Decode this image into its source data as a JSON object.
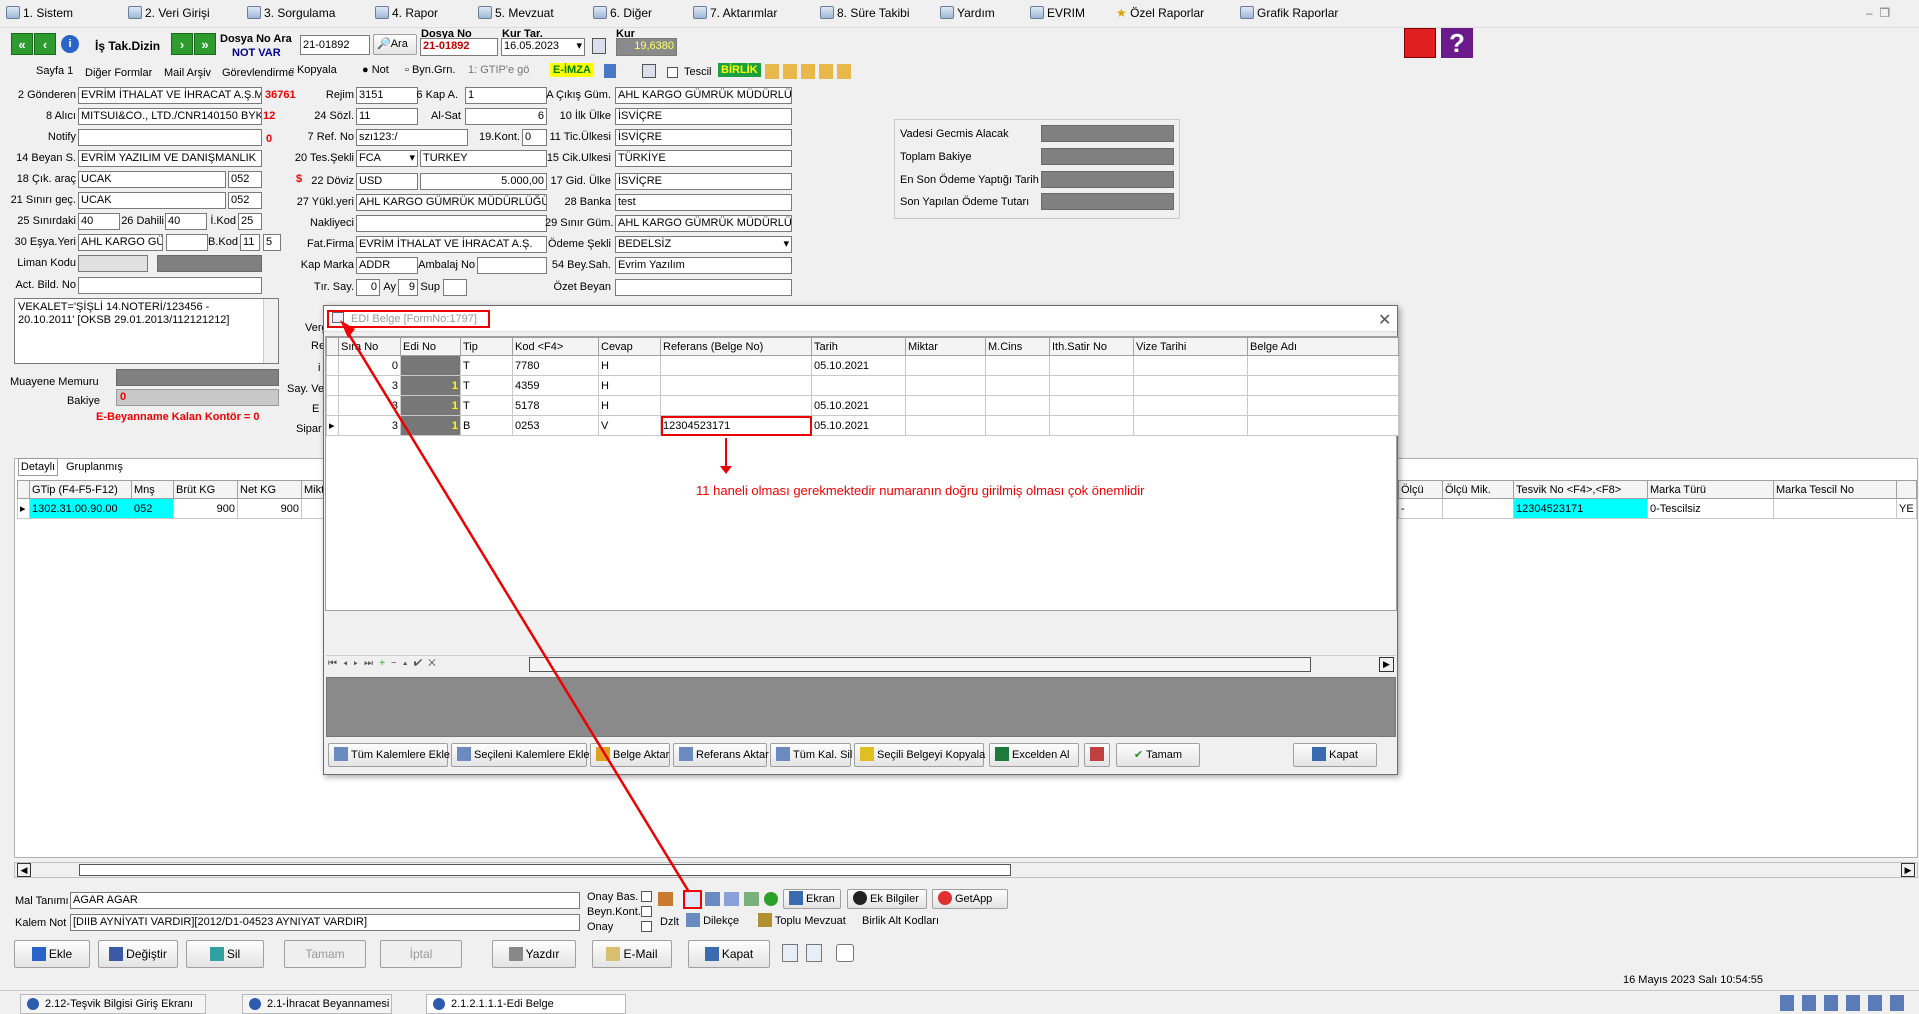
{
  "menu": [
    "1.  Sistem",
    "2.  Veri Girişi",
    "3.  Sorgulama",
    "4.  Rapor",
    "5.  Mevzuat",
    "6.  Diğer",
    "7.  Aktarımlar",
    "8. Süre Takibi",
    "Yardım",
    "EVRIM",
    "Özel Raporlar",
    "Grafik Raporlar"
  ],
  "toolbar": {
    "is_tak_dizin": "İş Tak.Dizin",
    "dosya_no_ara_label": "Dosya No Ara",
    "not_var": "NOT VAR",
    "dosya_no_ara_value": "21-01892",
    "ara_button": "Ara",
    "dosya_no_label": "Dosya No",
    "dosya_no_value": "21-01892",
    "kur_tar_label": "Kur Tar.",
    "kur_tar_value": "16.05.2023",
    "kur_label": "Kur",
    "kur_value": "19,6380"
  },
  "form_tabs": {
    "sayfa1": "Sayfa 1",
    "diger": "Diğer Formlar",
    "mail": "Mail Arşiv",
    "gorev": "Görevlendirme"
  },
  "form_toolbar": {
    "kopyala": "Kopyala",
    "not": "Not",
    "byn": "Byn.Grn.",
    "gtip": "1: GTIP'e gö",
    "eimza": "E-İMZA",
    "tescil": "Tescil",
    "birlik": "BİRLİK"
  },
  "left": {
    "gonderen_label": "2 Gönderen",
    "gonderen": "EVRİM İTHALAT VE İHRACAT A.Ş.M",
    "gonderen_no": "36761",
    "alici_label": "8 Alıcı",
    "alici": "MITSUI&CO., LTD./CNR140150 BYK",
    "alici_no": "12",
    "notify_label": "Notify",
    "notify_no": "0",
    "beyan_label": "14 Beyan S.",
    "beyan": "EVRİM YAZILIM VE DANIŞMANLIK",
    "cik_label": "18 Çık. araç",
    "cik": "UCAK",
    "cik_code": "052",
    "sinir_label": "21 Sınırı geç.",
    "sinir": "UCAK",
    "sinir_code": "052",
    "sinirdaki_label": "25 Sınırdaki",
    "sinirdaki": "40",
    "dahili_label": "26 Dahili",
    "dahili": "40",
    "ikod_label": "İ.Kod",
    "ikod": "25",
    "esya_label": "30 Eşya.Yeri",
    "esya": "AHL KARGO GÜ",
    "bkod_label": "B.Kod",
    "bkod": "11",
    "bkod2": "5",
    "liman_label": "Liman Kodu",
    "act_label": "Act. Bild. No",
    "vekalet": "VEKALET='ŞİŞLİ 14.NOTERİ/123456 - 20.10.2011' [OKSB 29.01.2013/112121212]",
    "muayene_label": "Muayene Memuru",
    "bakiye_label": "Bakiye",
    "bakiye": "0",
    "kontor": "E-Beyanname Kalan Kontör = 0"
  },
  "middle": {
    "rejim_label": "Rejim",
    "rejim": "3151",
    "kap_label": "6 Kap A.",
    "kap": "1",
    "sozl_label": "24 Sözl.",
    "sozl": "11",
    "alsat_label": "Al-Sat",
    "alsat": "6",
    "ref_label": "7 Ref. No",
    "ref": "szı123:/",
    "kont_label": "19.Kont.",
    "kont": "0",
    "tes_label": "20 Tes.Şekli",
    "tes": "FCA",
    "tes_yer": "TURKEY",
    "doviz_label": "22 Döviz",
    "doviz": "USD",
    "doviz_amount": "5.000,00",
    "dollar": "$",
    "yukl_label": "27 Yükl.yeri",
    "yukl": "AHL KARGO GÜMRÜK MÜDÜRLÜĞÜ",
    "nakliyeci_label": "Nakliyeci",
    "fat_label": "Fat.Firma",
    "fat": "EVRİM İTHALAT VE İHRACAT A.Ş.",
    "marka_label": "Kap Marka",
    "marka": "ADDR",
    "ambalaj_label": "Ambalaj No",
    "tir_label": "Tır. Say.",
    "tir": "0",
    "ay_label": "Ay",
    "ay": "9",
    "sup_label": "Sup"
  },
  "right": {
    "cikis_label": "A Çıkış Güm.",
    "cikis": "AHL KARGO GÜMRÜK MÜDÜRLÜĞ",
    "ilk_label": "10 İlk Ülke",
    "ilk": "İSVİÇRE",
    "tic_label": "11 Tic.Ülkesi",
    "tic": "İSVİÇRE",
    "cik_ulke_label": "15 Cik.Ulkesi",
    "cik_ulke": "TÜRKİYE",
    "gid_label": "17 Gid. Ülke",
    "gid": "İSVİÇRE",
    "banka_label": "28 Banka",
    "banka": "test",
    "sinir_gum_label": "29 Sınır Güm.",
    "sinir_gum": "AHL KARGO GÜMRÜK MÜDÜRLÜĞ",
    "odeme_label": "Ödeme Şekli",
    "odeme": "BEDELSİZ",
    "beysah_label": "54 Bey.Sah.",
    "beysah": "Evrim Yazılım",
    "ozet_label": "Özet Beyan"
  },
  "balance": {
    "vadesi": "Vadesi Gecmis Alacak",
    "toplam": "Toplam Bakiye",
    "en_son": "En Son Ödeme Yaptığı Tarih",
    "son_tutar": "Son Yapılan Ödeme Tutarı"
  },
  "detail": {
    "tabs": [
      "Detaylı",
      "Gruplanmış"
    ],
    "headers": [
      "GTip (F4-F5-F12)",
      "Mnş",
      "Brüt KG",
      "Net KG",
      "Mikta"
    ],
    "row": [
      "1302.31.00.90.00",
      "052",
      "900",
      "900"
    ],
    "right_headers": [
      "Ölçü",
      "Ölçü Mik.",
      "Tesvik No <F4>,<F8>",
      "Marka Türü",
      "Marka Tescil No"
    ],
    "right_row": [
      "-",
      "",
      "12304523171",
      "0-Tescilsiz",
      "",
      "YE"
    ]
  },
  "hidden_labels": [
    "Verg",
    "Re",
    "i",
    "Say. Ve",
    "E",
    "Sipar"
  ],
  "modal": {
    "title": "EDI Belge  [FormNo:1797]",
    "headers": [
      "Sıra No",
      "Edi No",
      "Tip",
      "Kod <F4>",
      "Cevap",
      "Referans (Belge No)",
      "Tarih",
      "Miktar",
      "M.Cins",
      "Ith.Satir No",
      "Vize Tarihi",
      "Belge Adı"
    ],
    "rows": [
      {
        "sira": "0",
        "edi": "",
        "tip": "T",
        "kod": "7780",
        "cevap": "H",
        "ref": "",
        "tarih": "05.10.2021"
      },
      {
        "sira": "3",
        "edi": "1",
        "tip": "T",
        "kod": "4359",
        "cevap": "H",
        "ref": "",
        "tarih": ""
      },
      {
        "sira": "3",
        "edi": "1",
        "tip": "T",
        "kod": "5178",
        "cevap": "H",
        "ref": "",
        "tarih": "05.10.2021"
      },
      {
        "sira": "3",
        "edi": "1",
        "tip": "B",
        "kod": "0253",
        "cevap": "V",
        "ref": "12304523171",
        "tarih": "05.10.2021"
      }
    ],
    "annotation": "11 haneli olması gerekmektedir numaranın doğru girilmiş olması çok önemlidir",
    "buttons": {
      "tum_ekle": "Tüm Kalemlere Ekle",
      "secileni_ekle": "Seçileni Kalemlere Ekle",
      "belge_aktar": "Belge Aktar",
      "referans_aktar": "Referans Aktar",
      "tum_sil": "Tüm Kal. Sil",
      "secili_kopyala": "Seçili Belgeyi Kopyala",
      "excel": "Excelden Al",
      "tamam": "Tamam",
      "kapat": "Kapat"
    }
  },
  "bottom": {
    "mal_label": "Mal Tanımı",
    "mal": "AGAR AGAR",
    "kalem_label": "Kalem Not",
    "kalem": "[DIIB AYNİYATI VARDIR][2012/D1-04523 AYNIYAT VARDIR]",
    "onay_bas": "Onay Bas.",
    "beyn_kont": "Beyn.Kont.",
    "onay": "Onay",
    "dzlt": "Dzlt",
    "ekran": "Ekran",
    "ek_bilgiler": "Ek Bilgiler",
    "getapp": "GetApp",
    "dilekce": "Dilekçe",
    "toplu": "Toplu Mevzuat",
    "birlik_alt": "Birlik Alt Kodları",
    "ekle": "Ekle",
    "degistir": "Değiştir",
    "sil": "Sil",
    "tamam": "Tamam",
    "iptal": "İptal",
    "yazdir": "Yazdır",
    "email": "E-Mail",
    "kapat": "Kapat"
  },
  "statusbar": {
    "tabs": [
      "2.12-Teşvik Bilgisi Giriş Ekranı",
      "2.1-İhracat Beyannamesi",
      "2.1.2.1.1.1-Edi Belge"
    ],
    "datetime": "16 Mayıs 2023 Salı 10:54:55"
  }
}
